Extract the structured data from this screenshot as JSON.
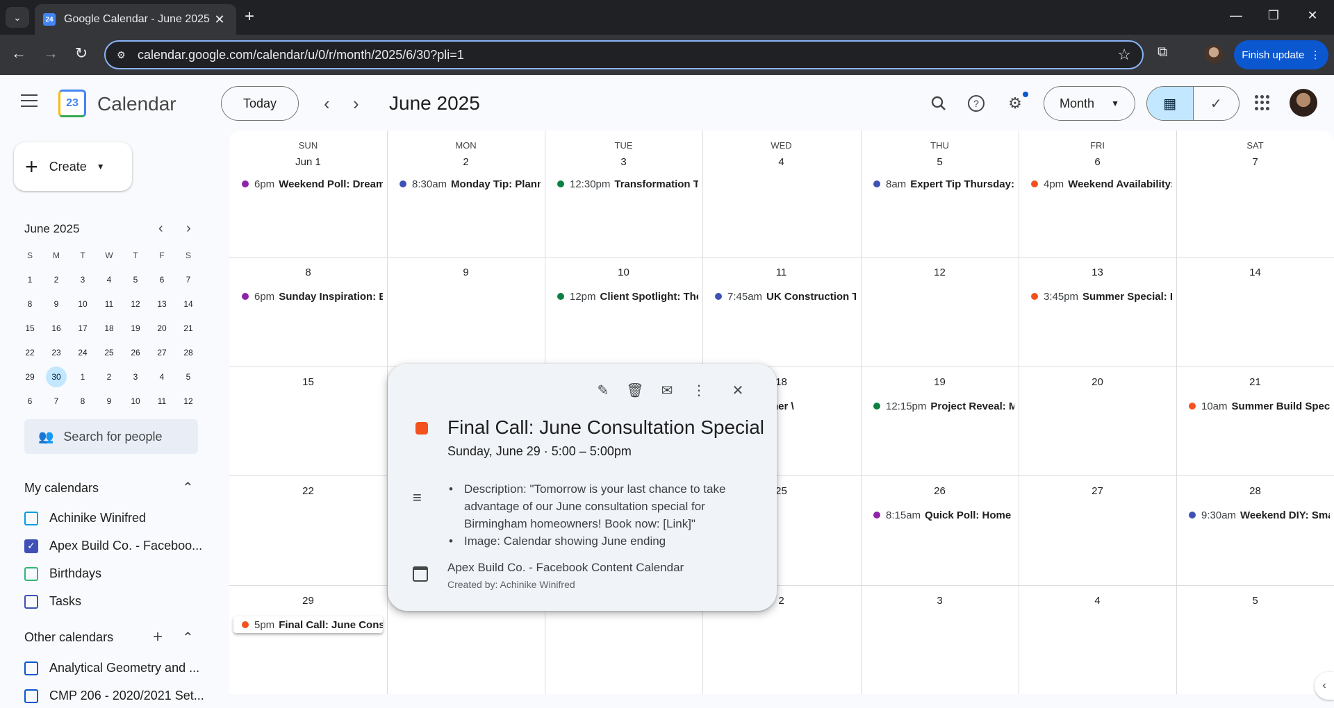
{
  "browser": {
    "tab_title": "Google Calendar - June 2025",
    "tab_favicon": "24",
    "url": "calendar.google.com/calendar/u/0/r/month/2025/6/30?pli=1",
    "finish_update": "Finish update"
  },
  "header": {
    "app_name": "Calendar",
    "logo_text": "23",
    "today": "Today",
    "month_title": "June 2025",
    "view": "Month"
  },
  "sidebar": {
    "create": "Create",
    "mini_title": "June 2025",
    "mini_dow": [
      "S",
      "M",
      "T",
      "W",
      "T",
      "F",
      "S"
    ],
    "mini_days": [
      "1",
      "2",
      "3",
      "4",
      "5",
      "6",
      "7",
      "8",
      "9",
      "10",
      "11",
      "12",
      "13",
      "14",
      "15",
      "16",
      "17",
      "18",
      "19",
      "20",
      "21",
      "22",
      "23",
      "24",
      "25",
      "26",
      "27",
      "28",
      "29",
      "30",
      "1",
      "2",
      "3",
      "4",
      "5",
      "6",
      "7",
      "8",
      "9",
      "10",
      "11",
      "12"
    ],
    "today_index": 29,
    "search_people": "Search for people",
    "my_calendars_title": "My calendars",
    "my_calendars": [
      {
        "name": "Achinike Winifred",
        "checked": false,
        "color": "#039be5"
      },
      {
        "name": "Apex Build Co. - Faceboo...",
        "checked": true,
        "color": "#3f51b5"
      },
      {
        "name": "Birthdays",
        "checked": false,
        "color": "#33b679"
      },
      {
        "name": "Tasks",
        "checked": false,
        "color": "#3f51b5"
      }
    ],
    "other_calendars_title": "Other calendars",
    "other_calendars": [
      {
        "name": "Analytical Geometry and ...",
        "checked": false,
        "color": "#0b57d0"
      },
      {
        "name": "CMP 206 - 2020/2021 Set...",
        "checked": false,
        "color": "#0b57d0"
      }
    ]
  },
  "calendar": {
    "dow": [
      "SUN",
      "MON",
      "TUE",
      "WED",
      "THU",
      "FRI",
      "SAT"
    ],
    "weeks": [
      [
        "Jun 1",
        "2",
        "3",
        "4",
        "5",
        "6",
        "7"
      ],
      [
        "8",
        "9",
        "10",
        "11",
        "12",
        "13",
        "14"
      ],
      [
        "15",
        "16",
        "17",
        "18",
        "19",
        "20",
        "21"
      ],
      [
        "22",
        "23",
        "24",
        "25",
        "26",
        "27",
        "28"
      ],
      [
        "29",
        "30",
        "1",
        "2",
        "3",
        "4",
        "5"
      ]
    ],
    "events": [
      {
        "week": 0,
        "day": 0,
        "time": "6pm",
        "title": "Weekend Poll: Dream",
        "color": "#8e24aa"
      },
      {
        "week": 0,
        "day": 1,
        "time": "8:30am",
        "title": "Monday Tip: Planni",
        "color": "#3f51b5"
      },
      {
        "week": 0,
        "day": 2,
        "time": "12:30pm",
        "title": "Transformation Tu",
        "color": "#0b8043"
      },
      {
        "week": 0,
        "day": 4,
        "time": "8am",
        "title": "Expert Tip Thursday: (",
        "color": "#3f51b5"
      },
      {
        "week": 0,
        "day": 5,
        "time": "4pm",
        "title": "Weekend Availability:",
        "color": "#f4511e"
      },
      {
        "week": 1,
        "day": 0,
        "time": "6pm",
        "title": "Sunday Inspiration: Br",
        "color": "#8e24aa"
      },
      {
        "week": 1,
        "day": 2,
        "time": "12pm",
        "title": "Client Spotlight: The",
        "color": "#0b8043"
      },
      {
        "week": 1,
        "day": 3,
        "time": "7:45am",
        "title": "UK Construction Ti",
        "color": "#3f51b5"
      },
      {
        "week": 1,
        "day": 5,
        "time": "3:45pm",
        "title": "Summer Special: Fr",
        "color": "#f4511e"
      },
      {
        "week": 2,
        "day": 3,
        "time": "",
        "title": "uld You Rather \\",
        "color": ""
      },
      {
        "week": 2,
        "day": 4,
        "time": "12:15pm",
        "title": "Project Reveal: Mc",
        "color": "#0b8043"
      },
      {
        "week": 2,
        "day": 6,
        "time": "10am",
        "title": "Summer Build Specia",
        "color": "#f4511e"
      },
      {
        "week": 3,
        "day": 4,
        "time": "8:15am",
        "title": "Quick Poll: Home O",
        "color": "#8e24aa"
      },
      {
        "week": 3,
        "day": 6,
        "time": "9:30am",
        "title": "Weekend DIY: Sma",
        "color": "#3f51b5"
      },
      {
        "week": 4,
        "day": 0,
        "time": "5pm",
        "title": "Final Call: June Consu",
        "color": "#f4511e",
        "selected": true
      }
    ]
  },
  "popup": {
    "title": "Final Call: June Consultation Special",
    "when": "Sunday, June 29  ·  5:00 – 5:00pm",
    "color": "#f4511e",
    "desc_1": "Description: \"Tomorrow is your last chance to take advantage of our June consultation special for Birmingham homeowners! Book now: [Link]\"",
    "desc_2": "Image: Calendar showing June ending",
    "calendar_name": "Apex Build Co. - Facebook Content Calendar",
    "creator": "Created by: Achinike Winifred"
  }
}
